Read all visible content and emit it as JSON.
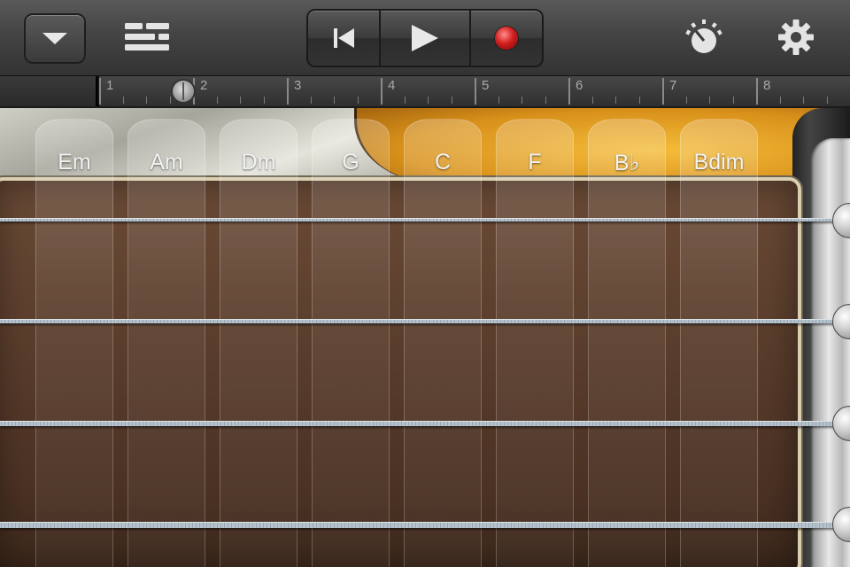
{
  "toolbar": {
    "dropdown_icon": "chevron-down-icon",
    "tracks_icon": "tracks-view-icon",
    "transport": {
      "rewind_icon": "rewind-to-start-icon",
      "play_icon": "play-icon",
      "record_icon": "record-icon",
      "record_color": "#d21e1e"
    },
    "metronome_icon": "metronome-icon",
    "settings_icon": "gear-icon"
  },
  "ruler": {
    "bars": [
      "1",
      "2",
      "3",
      "4",
      "5",
      "6",
      "7",
      "8"
    ],
    "playhead_bar": 1.9
  },
  "chords": [
    {
      "label": "Em"
    },
    {
      "label": "Am"
    },
    {
      "label": "Dm"
    },
    {
      "label": "G"
    },
    {
      "label": "C"
    },
    {
      "label": "F"
    },
    {
      "label": "B♭"
    },
    {
      "label": "Bdim"
    }
  ],
  "strings_visible": 4,
  "colors": {
    "fretboard": "#593c2b",
    "sunburst": "#f5bd3a",
    "binding": "#d9cfb1"
  }
}
